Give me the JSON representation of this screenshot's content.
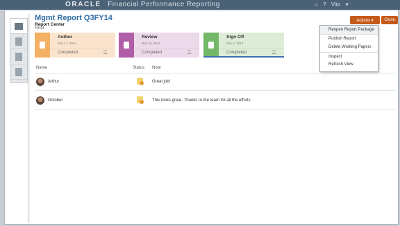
{
  "topbar": {
    "brand": "ORACLE",
    "app_title": "Financial Performance Reporting",
    "user": "Vito",
    "user_caret": "▾",
    "icons": [
      "home-icon",
      "help-icon"
    ]
  },
  "sidenav": {
    "items": [
      "grid-icon",
      "document-icon",
      "document-icon",
      "document-arrow-icon"
    ]
  },
  "header": {
    "title": "Mgmt Report Q3FY14",
    "subtitle": "Report Center",
    "state": "Final"
  },
  "buttons": {
    "actions": "Actions ▾",
    "close": "Close"
  },
  "actions_menu": [
    "Reopen Report Package",
    "Publish Report",
    "Delete Working Papers",
    "Inspect",
    "Refresh View"
  ],
  "stages": [
    {
      "name": "Author",
      "date": "Nov 17, 2014",
      "status": "Completed",
      "color": "#f2b164"
    },
    {
      "name": "Review",
      "date": "Nov 24, 2014",
      "status": "Completed",
      "color": "#b15ea8"
    },
    {
      "name": "Sign Off",
      "date": "Dec 2, 2014",
      "status": "Completed",
      "color": "#72b866"
    }
  ],
  "table": {
    "columns": [
      "Name",
      "Status",
      "Note"
    ],
    "rows": [
      {
        "name": "Arthur",
        "note": "Great job!"
      },
      {
        "name": "October",
        "note": "This looks great. Thanks to the team for all the efforts"
      }
    ]
  },
  "colors": {
    "accent": "#c65a1a",
    "title_blue": "#2f6ea6",
    "topbar": "#4a6176"
  }
}
